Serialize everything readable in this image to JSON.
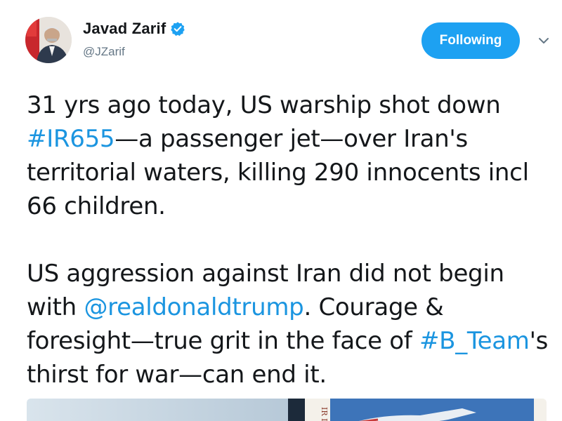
{
  "author": {
    "display_name": "Javad Zarif",
    "handle": "@JZarif",
    "verified": true
  },
  "actions": {
    "follow_label": "Following"
  },
  "tweet": {
    "p1_a": "31 yrs ago today, US warship shot down ",
    "p1_hashtag": "#IR655",
    "p1_b": "—a passenger jet—over Iran's territorial waters, killing 290 innocents incl 66 children.",
    "p2_a": "US aggression against Iran did not begin with ",
    "p2_mention": "@realdonaldtrump",
    "p2_b": ". Courage & foresight—true grit in the face of ",
    "p2_hashtag": "#B_Team",
    "p2_c": "'s thirst for war—can end it."
  },
  "media": {
    "stamp_text": "IR L"
  },
  "colors": {
    "link": "#1b95e0",
    "follow_button": "#1da1f2",
    "handle": "#657786",
    "text": "#14171a"
  },
  "icons": {
    "verified": "verified-badge-icon",
    "caret": "chevron-down-icon"
  }
}
